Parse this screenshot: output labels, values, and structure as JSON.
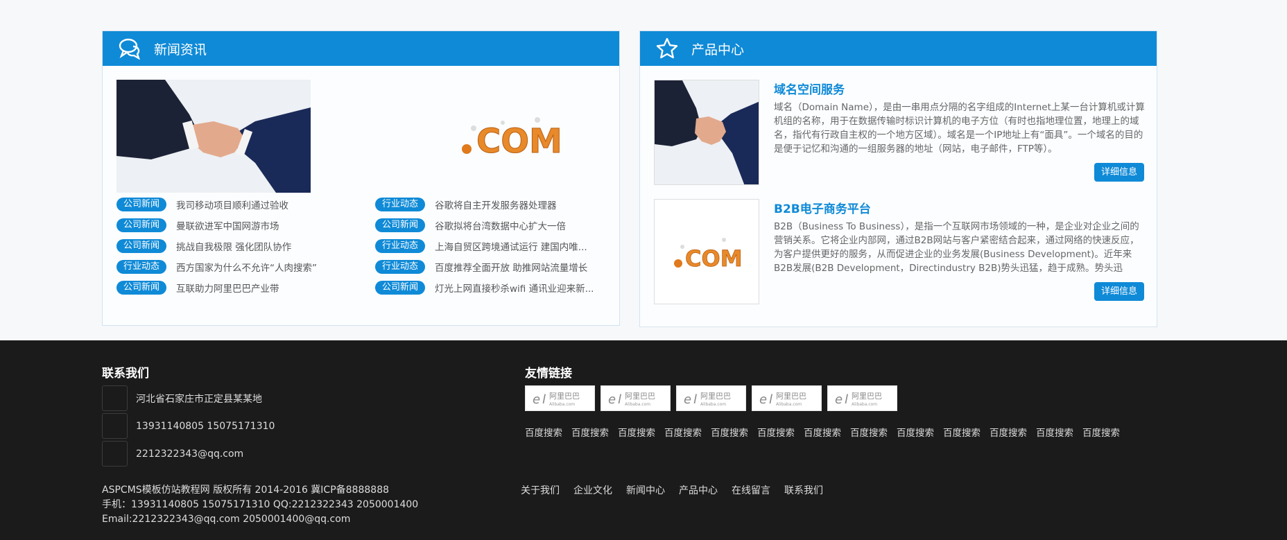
{
  "news": {
    "title": "新闻资讯",
    "items": [
      {
        "tag": "公司新闻",
        "title": "我司移动项目顺利通过验收"
      },
      {
        "tag": "行业动态",
        "title": "谷歌将自主开发服务器处理器"
      },
      {
        "tag": "公司新闻",
        "title": "曼联欲进军中国网游市场"
      },
      {
        "tag": "公司新闻",
        "title": "谷歌拟将台湾数据中心扩大一倍"
      },
      {
        "tag": "公司新闻",
        "title": "挑战自我极限 强化团队协作"
      },
      {
        "tag": "行业动态",
        "title": "上海自贸区跨境通试运行 建国内唯..."
      },
      {
        "tag": "行业动态",
        "title": "西方国家为什么不允许“人肉搜索”"
      },
      {
        "tag": "行业动态",
        "title": "百度推荐全面开放 助推网站流量增长"
      },
      {
        "tag": "公司新闻",
        "title": "互联助力阿里巴巴产业带"
      },
      {
        "tag": "公司新闻",
        "title": "灯光上网直接秒杀wifi 通讯业迎来新..."
      }
    ]
  },
  "products": {
    "title": "产品中心",
    "items": [
      {
        "title": "域名空间服务",
        "desc": "域名（Domain Name），是由一串用点分隔的名字组成的Internet上某一台计算机或计算机组的名称，用于在数据传输时标识计算机的电子方位（有时也指地理位置，地理上的域名，指代有行政自主权的一个地方区域）。域名是一个IP地址上有“面具”。一个域名的目的是便于记忆和沟通的一组服务器的地址（网站，电子邮件，FTP等）。",
        "more": "详细信息"
      },
      {
        "title": "B2B电子商务平台",
        "desc": "B2B（Business To Business），是指一个互联网市场领域的一种，是企业对企业之间的营销关系。它将企业内部网，通过B2B网站与客户紧密结合起来，通过网络的快速反应，为客户提供更好的服务，从而促进企业的业务发展(Business Development)。近年来B2B发展(B2B Development，Directindustry B2B)势头迅猛，趋于成熟。势头迅",
        "more": "详细信息"
      }
    ]
  },
  "footer": {
    "contact_title": "联系我们",
    "address": "河北省石家庄市正定县某某地",
    "phone": "13931140805 15075171310",
    "email": "2212322343@qq.com",
    "links_title": "友情链接",
    "logo_text": "阿里巴巴",
    "logo_sub": "Alibaba.com",
    "links": [
      "百度搜索",
      "百度搜索",
      "百度搜索",
      "百度搜索",
      "百度搜索",
      "百度搜索",
      "百度搜索",
      "百度搜索",
      "百度搜索",
      "百度搜索",
      "百度搜索",
      "百度搜索",
      "百度搜索"
    ],
    "copyright": "ASPCMS模板仿站教程网 版权所有 2014-2016 冀ICP备8888888",
    "phone_line": "手机：13931140805 15075171310 QQ:2212322343 2050001400",
    "email_line": "Email:2212322343@qq.com 2050001400@qq.com",
    "nav": [
      "关于我们",
      "企业文化",
      "新闻中心",
      "产品中心",
      "在线留言",
      "联系我们"
    ]
  },
  "colors": {
    "accent": "#0f8ad7",
    "footer_bg": "#1b1b1b"
  },
  "icons": {
    "news": "chat-bubbles-icon",
    "products": "star-icon"
  }
}
